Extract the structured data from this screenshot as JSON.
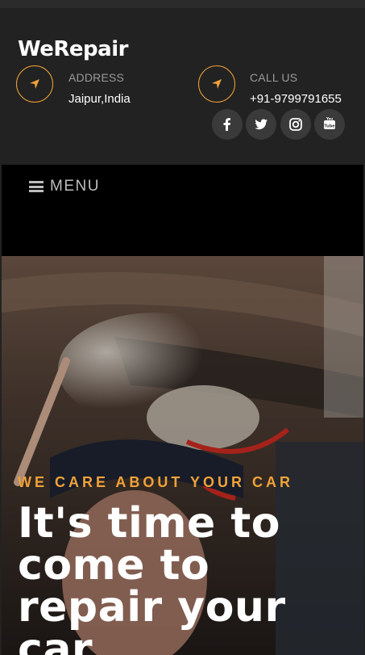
{
  "header": {
    "brand": "WeRepair",
    "address": {
      "label": "ADDRESS",
      "value": "Jaipur,India",
      "icon": "location-arrow-icon"
    },
    "phone": {
      "label": "CALL US",
      "value": "+91-9799791655",
      "icon": "location-arrow-icon"
    },
    "social": [
      {
        "name": "facebook-icon"
      },
      {
        "name": "twitter-icon"
      },
      {
        "name": "instagram-icon"
      },
      {
        "name": "youtube-icon"
      }
    ]
  },
  "nav": {
    "menu_label": "MENU",
    "icon": "hamburger-icon"
  },
  "hero": {
    "tagline": "WE CARE ABOUT YOUR CAR",
    "title": "It's time to come to repair your car"
  },
  "colors": {
    "accent": "#f0a23a",
    "header_bg": "#222222",
    "nav_bg": "#000000"
  }
}
